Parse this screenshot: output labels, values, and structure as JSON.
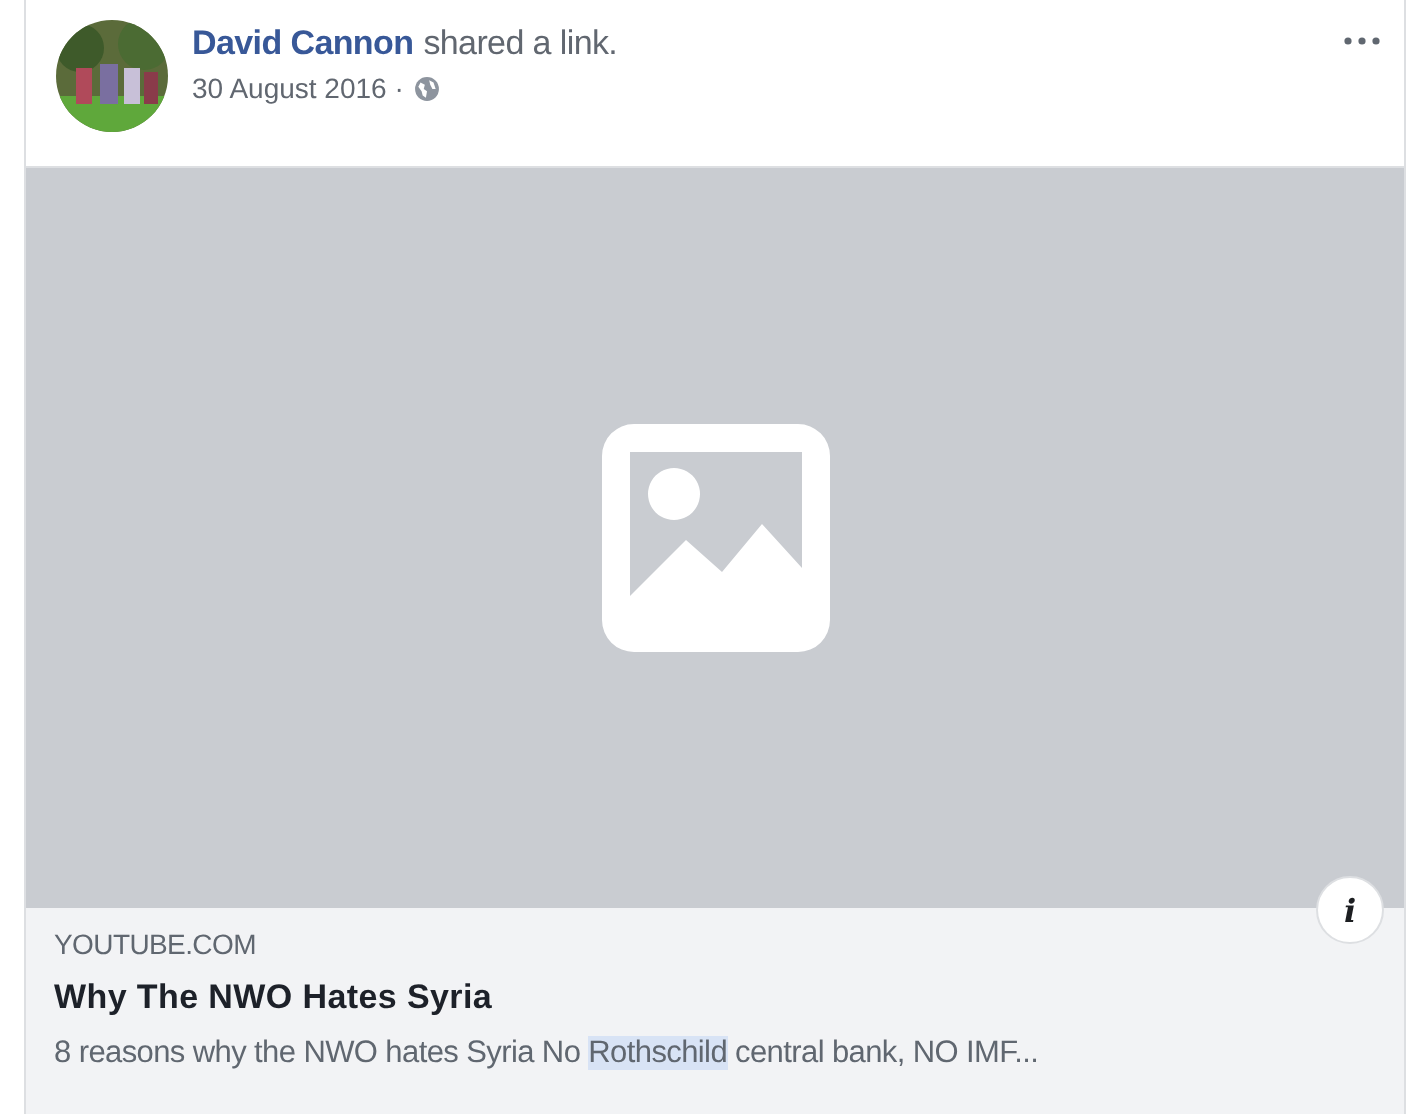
{
  "post": {
    "author": "David Cannon",
    "action": "shared a link.",
    "date": "30 August 2016 ·"
  },
  "link_preview": {
    "image": {
      "kind": "placeholder"
    },
    "info_button": "i",
    "domain": "YOUTUBE.COM",
    "title": "Why The NWO Hates Syria",
    "description": [
      {
        "text": "8 reasons why the NWO hates Syria No ",
        "highlighted": false
      },
      {
        "text": "Rothschild",
        "highlighted": true
      },
      {
        "text": " central bank, NO IMF...",
        "highlighted": false
      }
    ]
  }
}
